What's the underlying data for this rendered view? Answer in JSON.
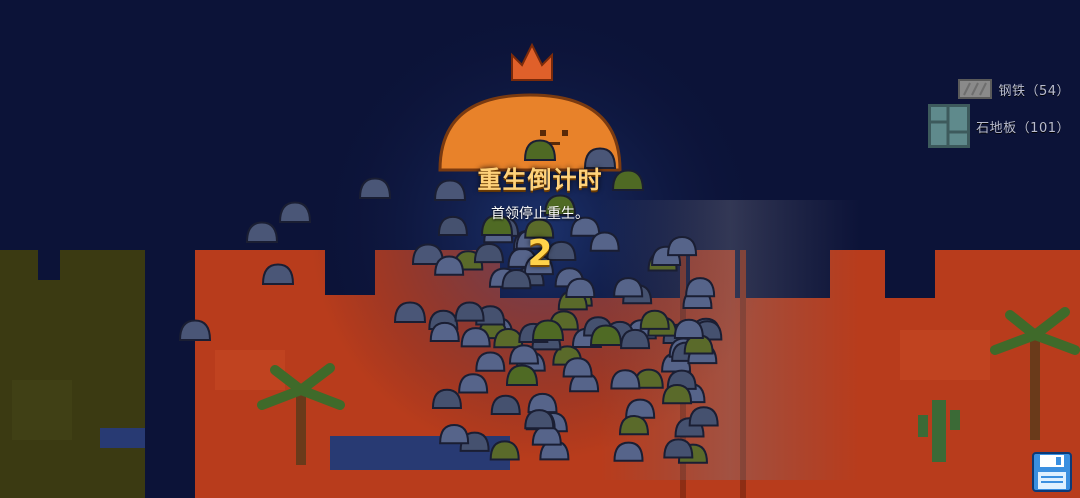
{
  "inventory": [
    {
      "label": "钢铁（54）",
      "icon": "steel-block-icon",
      "color": "#8a8a8a"
    },
    {
      "label": "石地板（101）",
      "icon": "stone-floor-icon",
      "color": "#5f8a8c"
    }
  ],
  "respawn": {
    "title": "重生倒计时",
    "subtitle": "首领停止重生。",
    "countdown": "2"
  },
  "save_button": {
    "icon": "save-icon",
    "color": "#3a8fe0"
  },
  "colors": {
    "sky": "#0c1338",
    "sand": "#c8421f",
    "grass": "#3a3a10",
    "boss": "#e8822a",
    "slime": "#4a5677"
  }
}
